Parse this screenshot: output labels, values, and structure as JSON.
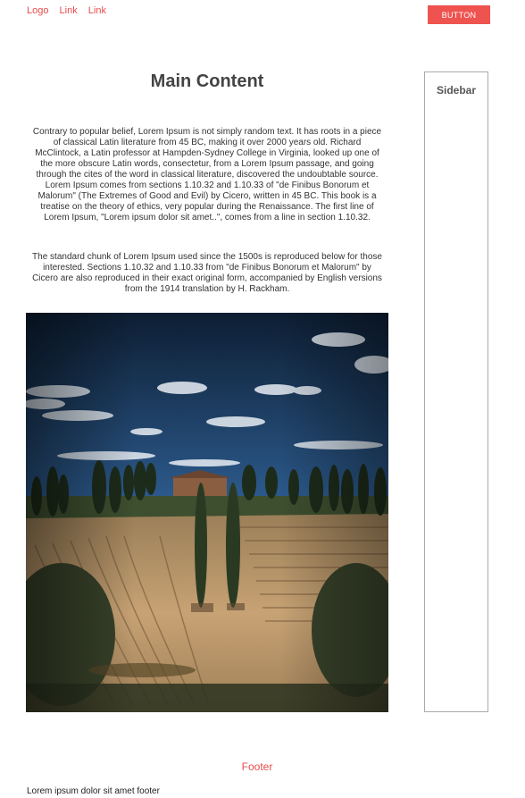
{
  "nav": {
    "logo": "Logo",
    "links": [
      "Link",
      "Link"
    ]
  },
  "header_button": "BUTTON",
  "main": {
    "title": "Main Content",
    "paragraphs": [
      "Contrary to popular belief, Lorem Ipsum is not simply random text. It has roots in a piece of classical Latin literature from 45 BC, making it over 2000 years old. Richard McClintock, a Latin professor at Hampden-Sydney College in Virginia, looked up one of the more obscure Latin words, consectetur, from a Lorem Ipsum passage, and going through the cites of the word in classical literature, discovered the undoubtable source. Lorem Ipsum comes from sections 1.10.32 and 1.10.33 of \"de Finibus Bonorum et Malorum\" (The Extremes of Good and Evil) by Cicero, written in 45 BC. This book is a treatise on the theory of ethics, very popular during the Renaissance. The first line of Lorem Ipsum, \"Lorem ipsum dolor sit amet..\", comes from a line in section 1.10.32.",
      "The standard chunk of Lorem Ipsum used since the 1500s is reproduced below for those interested. Sections 1.10.32 and 1.10.33 from \"de Finibus Bonorum et Malorum\" by Cicero are also reproduced in their exact original form, accompanied by English versions from the 1914 translation by H. Rackham."
    ]
  },
  "sidebar": {
    "title": "Sidebar"
  },
  "footer": {
    "title": "Footer",
    "text": "Lorem ipsum dolor sit amet footer"
  },
  "colors": {
    "accent": "#ef5350",
    "link": "#e84c4c",
    "border": "#aaaaaa"
  }
}
